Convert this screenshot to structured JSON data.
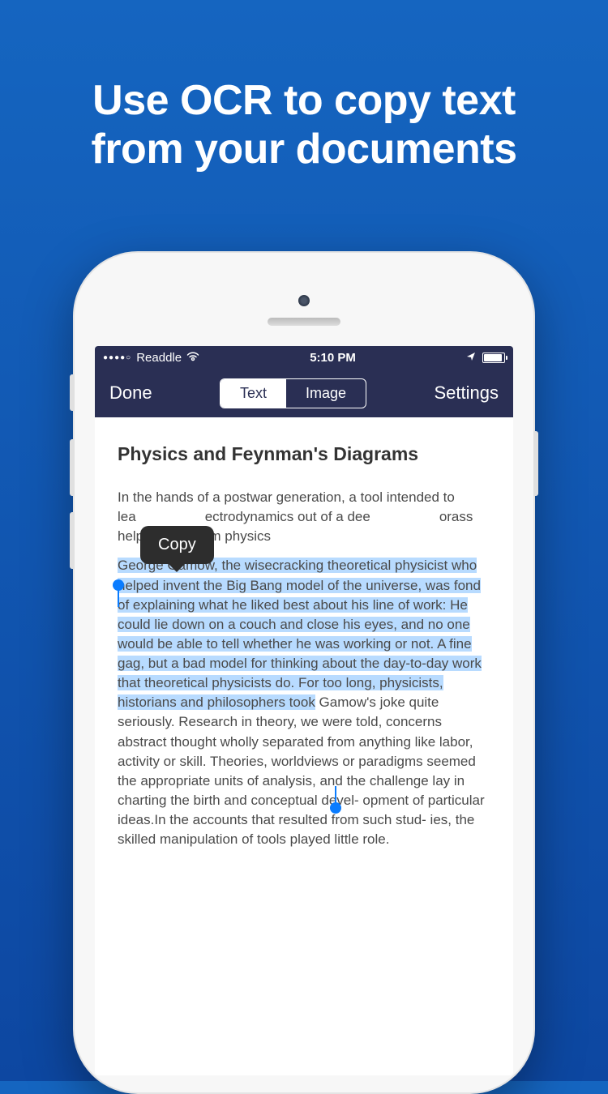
{
  "hero": {
    "line1": "Use OCR to copy text",
    "line2": "from your documents"
  },
  "status": {
    "carrier": "Readdle",
    "time": "5:10 PM"
  },
  "nav": {
    "left": "Done",
    "segment_text": "Text",
    "segment_image": "Image",
    "right": "Settings"
  },
  "popup": {
    "copy": "Copy"
  },
  "document": {
    "title": "Physics and Feynman's Diagrams",
    "intro_before": "In the hands of a postwar generation, a tool intended to lea",
    "intro_mid": "ectrodynamics out of a dee",
    "intro_after": "orass helped transform physics",
    "body_hl": "George Gamow, the wisecracking theoretical physicist who helped invent the Big Bang model of the universe, was fond of explaining what he liked best about his line of work: He could lie down on a couch and close his eyes, and no one would be able to tell whether he was working or not. A fine gag, but a bad model for thinking about the day-to-day work that theoretical physicists do. For too long, physicists, historians and philosophers took",
    "body_rest": " Gamow's joke quite seriously. Research in theory, we were told, concerns abstract thought wholly separated from anything like labor, activity or skill. Theories, worldviews or paradigms seemed the appropriate units of analysis, and the challenge lay in charting the birth and conceptual devel- opment of particular ideas.In the accounts that resulted from such stud- ies, the skilled manipulation of tools played little role."
  }
}
